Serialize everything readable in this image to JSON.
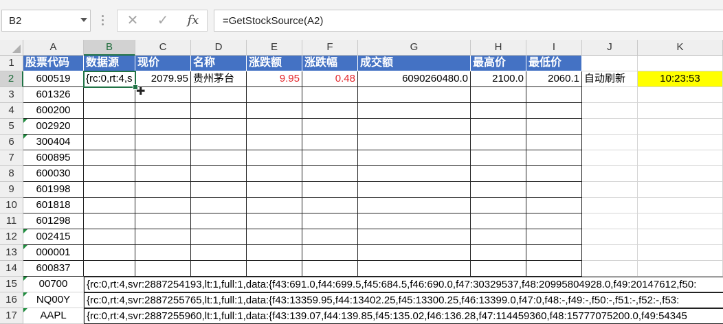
{
  "formula_bar": {
    "name_box": "B2",
    "cancel_icon": "✕",
    "enter_icon": "✓",
    "fx_icon": "fx",
    "formula": "=GetStockSource(A2)"
  },
  "columns": [
    "A",
    "B",
    "C",
    "D",
    "E",
    "F",
    "G",
    "H",
    "I",
    "J",
    "K"
  ],
  "rows": [
    "1",
    "2",
    "3",
    "4",
    "5",
    "6",
    "7",
    "8",
    "9",
    "10",
    "11",
    "12",
    "13",
    "14",
    "15",
    "16",
    "17"
  ],
  "header_row": [
    "股票代码",
    "数据源",
    "现价",
    "名称",
    "涨跌额",
    "涨跌幅",
    "成交额",
    "最高价",
    "最低价"
  ],
  "row2": {
    "code": "600519",
    "source": "{rc:0,rt:4,s",
    "price": "2079.95",
    "name": "贵州茅台",
    "change": "9.95",
    "change_pct": "0.48",
    "turnover": "6090260480.0",
    "high": "2100.0",
    "low": "2060.1",
    "auto_label": "自动刷新",
    "time": "10:23:53"
  },
  "codes": [
    "601326",
    "600200",
    "002920",
    "300404",
    "600895",
    "600030",
    "601998",
    "601818",
    "601298",
    "002415",
    "000001",
    "600837"
  ],
  "bottom_rows": [
    {
      "code": "00700",
      "source": "{rc:0,rt:4,svr:2887254193,lt:1,full:1,data:{f43:691.0,f44:699.5,f45:684.5,f46:690.0,f47:30329537,f48:20995804928.0,f49:20147612,f50:"
    },
    {
      "code": "NQ00Y",
      "source": "{rc:0,rt:4,svr:2887255765,lt:1,full:1,data:{f43:13359.95,f44:13402.25,f45:13300.25,f46:13399.0,f47:0,f48:-,f49:-,f50:-,f51:-,f52:-,f53:"
    },
    {
      "code": "AAPL",
      "source": "{rc:0,rt:4,svr:2887255960,lt:1,full:1,data:{f43:139.07,f44:139.85,f45:135.02,f46:136.28,f47:114459360,f48:15777075200.0,f49:54345"
    }
  ],
  "colors": {
    "header_bg": "#4472c4",
    "negative_red": "#e3262b",
    "highlight_yellow": "#ffff00",
    "selection_green": "#217346"
  }
}
